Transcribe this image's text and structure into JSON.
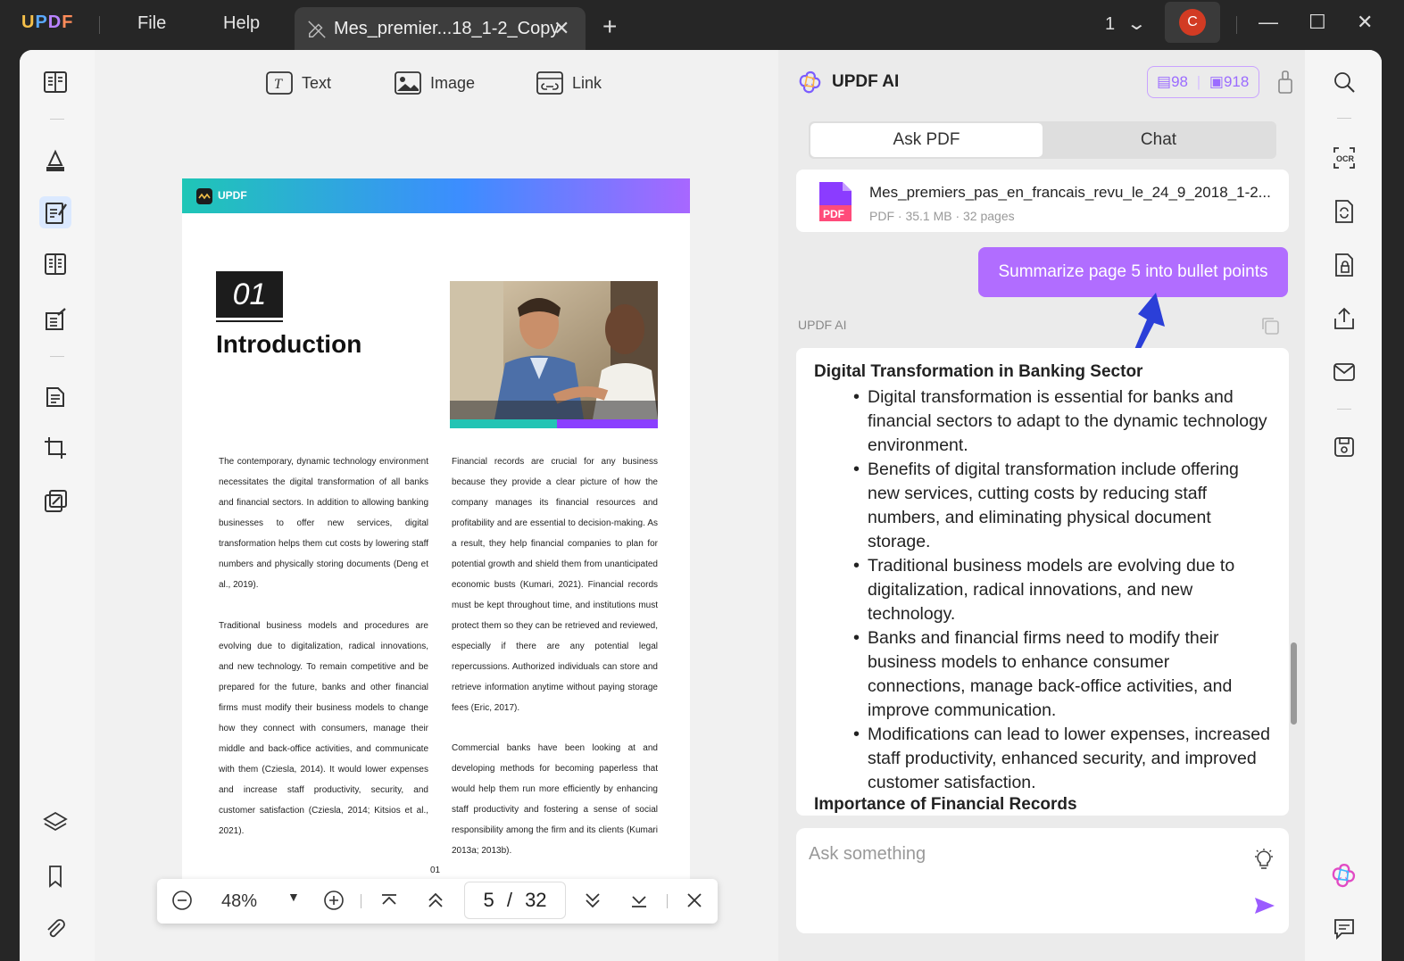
{
  "titlebar": {
    "logo": "UPDF",
    "menu_file": "File",
    "menu_help": "Help",
    "tab_label": "Mes_premier...18_1-2_Copy",
    "page_selector": "1",
    "avatar_letter": "C"
  },
  "edit_toolbar": {
    "text_label": "Text",
    "image_label": "Image",
    "link_label": "Link"
  },
  "document": {
    "header_brand": "UPDF",
    "chapter_number": "01",
    "chapter_title": "Introduction",
    "col1_p1": "The contemporary, dynamic technology environment necessitates the digital transformation of all banks and financial sectors. In addition to allowing banking businesses to offer new services, digital transformation helps them cut costs by lowering staff numbers and physically storing documents (Deng et al., 2019).",
    "col1_p2": "Traditional business models and procedures are evolving due to digitalization, radical innovations, and new technology. To remain competitive and be prepared for the future, banks and other financial firms must modify their business models to change how they connect with consumers, manage their middle and back-office activities, and communicate with them (Cziesla, 2014). It would lower expenses and increase staff productivity, security, and customer satisfaction (Cziesla, 2014; Kitsios et al., 2021).",
    "col2_p1": "Financial records are crucial for any business because they provide a clear picture of how the company manages its financial resources and profitability and are essential to decision-making. As a result, they help financial companies to plan for potential growth and shield them from unanticipated economic busts (Kumari, 2021). Financial records must be kept throughout time, and institutions must protect them so they can be retrieved and reviewed, especially if there are any potential legal repercussions. Authorized individuals can store and retrieve information anytime without paying storage fees (Eric, 2017).",
    "col2_p2": "Commercial banks have been looking at and developing methods for becoming paperless that would help them run more efficiently by enhancing staff productivity and fostering a sense of social responsibility among the firm and its clients (Kumari 2013a; 2013b).",
    "page_footer_number": "01"
  },
  "page_bar": {
    "zoom": "48%",
    "current_page": "5",
    "separator": "/",
    "total_pages": "32"
  },
  "ai_panel": {
    "title": "UPDF AI",
    "credits_doc": "98",
    "credits_chat": "918",
    "tab_ask_pdf": "Ask PDF",
    "tab_chat": "Chat",
    "file_name": "Mes_premiers_pas_en_francais_revu_le_24_9_2018_1-2...",
    "file_meta": "PDF · 35.1 MB · 32 pages",
    "file_icon_label": "PDF",
    "user_message": "Summarize page 5 into bullet points",
    "ai_label": "UPDF AI",
    "answer_heading1": "Digital Transformation in Banking Sector",
    "bullets": [
      "Digital transformation is essential for banks and financial sectors to adapt to the dynamic technology environment.",
      "Benefits of digital transformation include offering new services, cutting costs by reducing staff numbers, and eliminating physical document storage.",
      "Traditional business models are evolving due to digitalization, radical innovations, and new technology.",
      "Banks and financial firms need to modify their business models to enhance consumer connections, manage back-office activities, and improve communication.",
      "Modifications can lead to lower expenses, increased staff productivity, enhanced security, and improved customer satisfaction."
    ],
    "answer_heading2": "Importance of Financial Records",
    "ask_placeholder": "Ask something"
  },
  "colors": {
    "accent_purple": "#b16dff",
    "active_tool_bg": "#dbe9ff",
    "avatar_red": "#d23b23",
    "send_purple": "#9b5cff",
    "annotation_arrow": "#2b3fd8"
  }
}
